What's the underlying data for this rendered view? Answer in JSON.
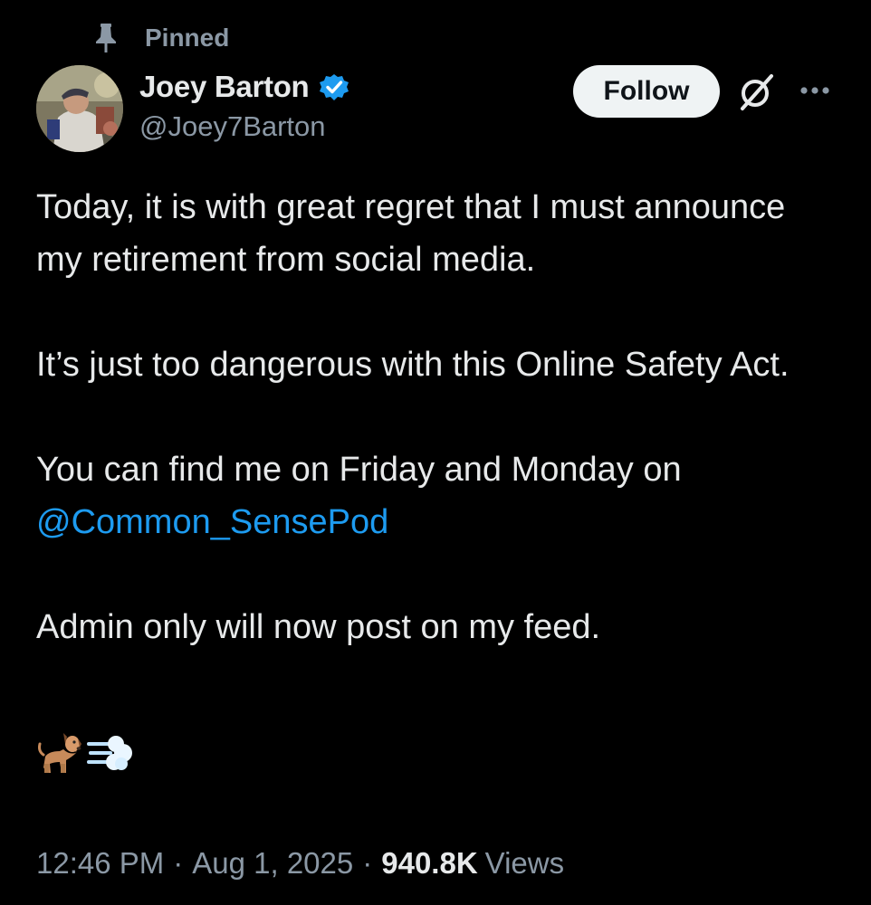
{
  "pinned": {
    "label": "Pinned",
    "icon": "pin-icon"
  },
  "author": {
    "display_name": "Joey Barton",
    "handle": "@Joey7Barton",
    "verified": true,
    "verified_color": "#1d9bf0"
  },
  "actions": {
    "follow_label": "Follow",
    "grok_icon": "grok-icon",
    "more_icon": "more-options-icon"
  },
  "tweet": {
    "paragraph_1": "Today, it is with great regret that I must announce my retirement from social media.",
    "paragraph_2": "It’s just too dangerous with this Online Safety Act.",
    "paragraph_3_text": "You can find me on Friday and Monday on",
    "paragraph_3_mention": "@Common_SensePod",
    "paragraph_4": "Admin only will now post on my feed.",
    "emojis": [
      "dog-emoji",
      "dash-emoji"
    ]
  },
  "meta": {
    "time": "12:46 PM",
    "separator": "·",
    "date": "Aug 1, 2025",
    "views_count": "940.8K",
    "views_label": "Views"
  },
  "colors": {
    "background": "#000000",
    "primary_text": "#e7e9ea",
    "secondary_text": "#8b98a5",
    "link": "#1d9bf0",
    "follow_bg": "#eff3f4"
  }
}
